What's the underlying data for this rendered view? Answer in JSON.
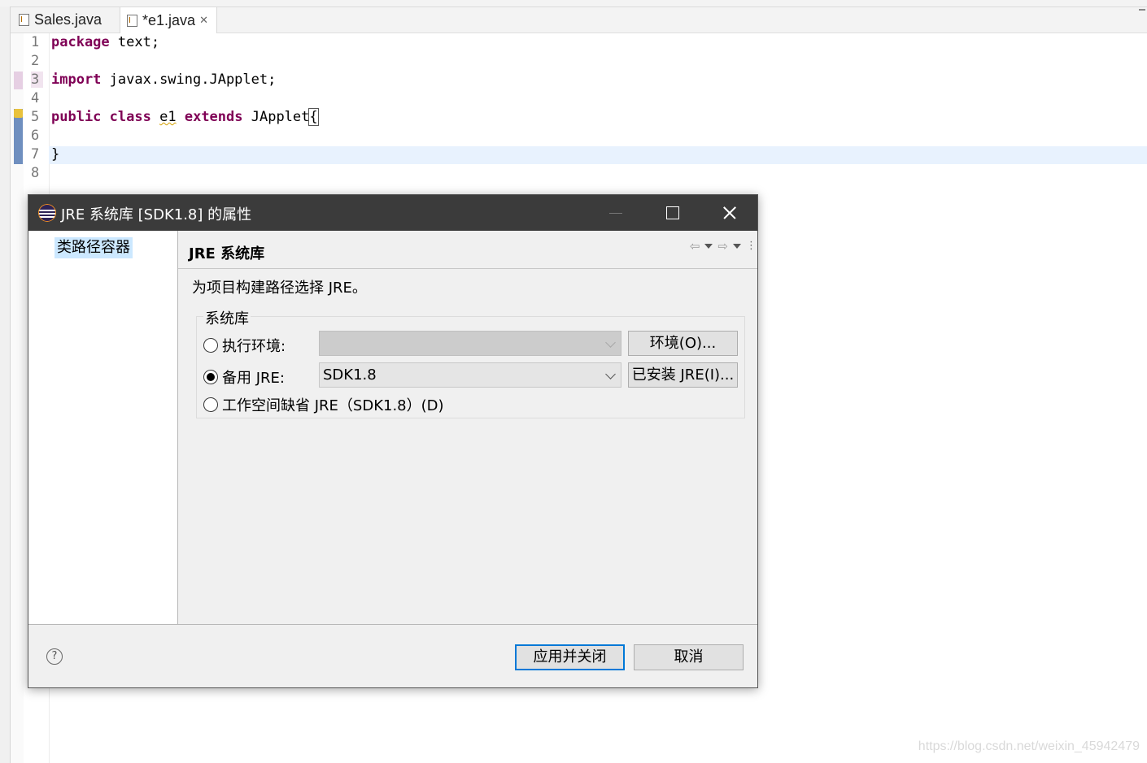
{
  "editor": {
    "tabs": [
      {
        "label": "Sales.java"
      },
      {
        "label": "*e1.java",
        "close": "✕"
      }
    ],
    "line_numbers": [
      "1",
      "2",
      "3",
      "4",
      "5",
      "6",
      "7",
      "8"
    ],
    "code": {
      "line1_kw": "package",
      "line1_rest": " text;",
      "line3_kw": "import",
      "line3_rest": " javax.swing.JApplet;",
      "line5_kw1": "public",
      "line5_kw2": "class",
      "line5_name": "e1",
      "line5_kw3": "extends",
      "line5_type": " JApplet",
      "line5_brace": "{",
      "line7": "}"
    }
  },
  "watermark": "https://blog.csdn.net/weixin_45942479",
  "dialog": {
    "title": "JRE 系统库 [SDK1.8] 的属性",
    "nav": {
      "items": [
        {
          "label": "类路径容器"
        }
      ]
    },
    "page_title": "JRE 系统库",
    "description": "为项目构建路径选择 JRE。",
    "group": {
      "legend": "系统库",
      "options": [
        {
          "label": "执行环境:",
          "selected": false,
          "select_value": "",
          "button": "环境(O)..."
        },
        {
          "label": "备用 JRE:",
          "selected": true,
          "select_value": "SDK1.8",
          "button": "已安装 JRE(I)..."
        },
        {
          "label": "工作空间缺省 JRE（SDK1.8）(D)",
          "selected": false
        }
      ]
    },
    "buttons": {
      "apply_close": "应用并关闭",
      "cancel": "取消",
      "help": "?"
    }
  },
  "colors": {
    "keyword": "#7f0055",
    "title_bar": "#3b3b3b",
    "selection": "#cce8ff",
    "default_button_border": "#0078d7"
  }
}
